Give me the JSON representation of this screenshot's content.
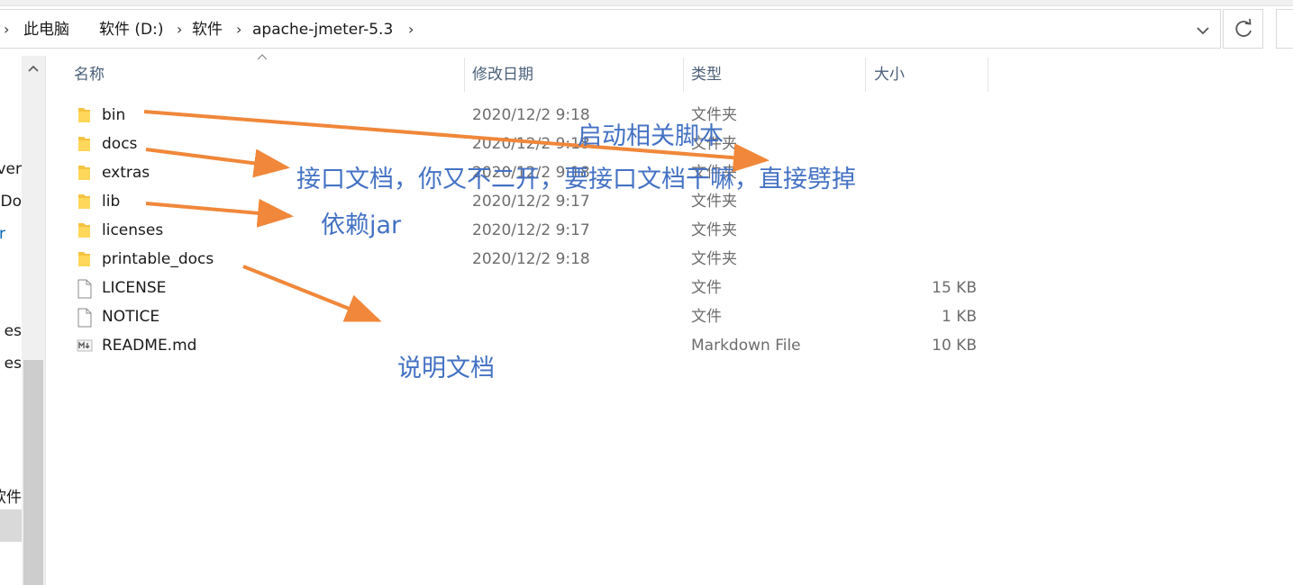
{
  "breadcrumb": [
    "此电脑",
    "软件 (D:)",
    "软件",
    "apache-jmeter-5.3"
  ],
  "nav_items": [
    "ver",
    "eDo",
    "r",
    "es",
    "es",
    "软件"
  ],
  "columns": {
    "name": "名称",
    "date": "修改日期",
    "type": "类型",
    "size": "大小"
  },
  "files": [
    {
      "name": "bin",
      "date": "2020/12/2 9:18",
      "type": "文件夹",
      "size": "",
      "icon": "folder-icon"
    },
    {
      "name": "docs",
      "date": "2020/12/2 9:18",
      "type": "文件夹",
      "size": "",
      "icon": "folder-icon"
    },
    {
      "name": "extras",
      "date": "2020/12/2 9:18",
      "type": "文件夹",
      "size": "",
      "icon": "folder-icon"
    },
    {
      "name": "lib",
      "date": "2020/12/2 9:17",
      "type": "文件夹",
      "size": "",
      "icon": "folder-icon"
    },
    {
      "name": "licenses",
      "date": "2020/12/2 9:17",
      "type": "文件夹",
      "size": "",
      "icon": "folder-icon"
    },
    {
      "name": "printable_docs",
      "date": "2020/12/2 9:18",
      "type": "文件夹",
      "size": "",
      "icon": "folder-icon"
    },
    {
      "name": "LICENSE",
      "date": "",
      "type": "文件",
      "size": "15 KB",
      "icon": "file-icon"
    },
    {
      "name": "NOTICE",
      "date": "",
      "type": "文件",
      "size": "1 KB",
      "icon": "file-icon"
    },
    {
      "name": "README.md",
      "date": "",
      "type": "Markdown File",
      "size": "10 KB",
      "icon": "markdown-file-icon"
    }
  ],
  "annotations": {
    "bin": "启动相关脚本",
    "docs": "接口文档，你又不二开，要接口文档干嘛，直接劈掉",
    "lib": "依赖jar",
    "printable_docs": "说明文档"
  },
  "colors": {
    "annotation_text": "#4472c4",
    "arrow": "#f0873a",
    "folder": "#f5c342",
    "header_text": "#4c607a"
  },
  "icons": {
    "dropdown": "chevron-down-icon",
    "refresh": "refresh-icon",
    "scroll_up": "scroll-up-icon",
    "sort": "sort-ascending-icon"
  }
}
